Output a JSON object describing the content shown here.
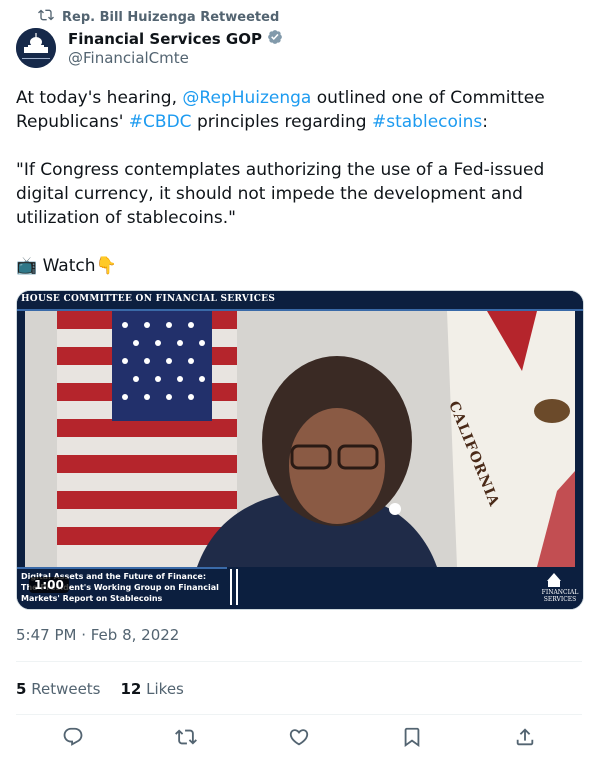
{
  "retweet_banner": {
    "text": "Rep. Bill Huizenga Retweeted"
  },
  "author": {
    "name": "Financial Services GOP",
    "handle": "@FinancialCmte",
    "avatar_text": "FINANCIAL SERVICES"
  },
  "tweet": {
    "p1_a": "At today's hearing, ",
    "p1_mention": "@RepHuizenga",
    "p1_b": " outlined one of Committee Republicans' ",
    "p1_tag1": "#CBDC",
    "p1_c": " principles regarding ",
    "p1_tag2": "#stablecoins",
    "p1_d": ":",
    "p2": "\"If Congress contemplates authorizing the use of a Fed-issued digital currency, it should not impede the development and utilization of stablecoins.\"",
    "p3_tv": "📺",
    "p3_text": " Watch",
    "p3_point": "👇"
  },
  "video": {
    "header": "HOUSE COMMITTEE ON FINANCIAL SERVICES",
    "duration": "1:00",
    "caption_line1": "Digital Assets and the Future of Finance:",
    "caption_line2": "The President's Working Group on Financial",
    "caption_line3": "Markets' Report on Stablecoins",
    "flag_text": "CALIFORNIA",
    "logo_line1": "FINANCIAL",
    "logo_line2": "SERVICES"
  },
  "meta": {
    "timestamp": "5:47 PM · Feb 8, 2022"
  },
  "stats": {
    "retweets_count": "5",
    "retweets_label": "Retweets",
    "likes_count": "12",
    "likes_label": "Likes"
  },
  "colors": {
    "link": "#1d9bf0",
    "verified": "#829aab",
    "muted": "#536471"
  }
}
